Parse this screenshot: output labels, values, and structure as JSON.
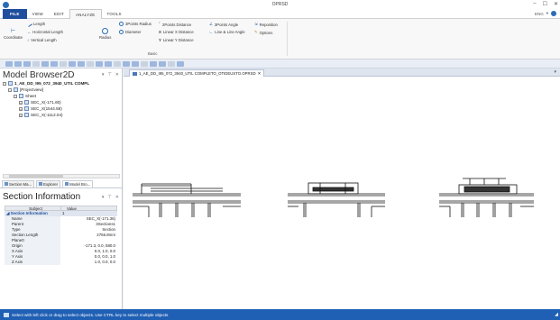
{
  "window": {
    "title": "OPRSD",
    "controls": [
      "–",
      "☐",
      "✕"
    ]
  },
  "menu": {
    "items": [
      "FILE",
      "VIEW",
      "EDIT",
      "ANALYZE",
      "TOOLS"
    ],
    "active": "ANALYZE",
    "user": "ENG"
  },
  "ribbon": {
    "coordinate": "Coordinate",
    "length": "Length",
    "horizontal_length": "Horizontal Length",
    "vertical_length": "Vertical Length",
    "radius": "Radius",
    "three_points_radius": "3Points Radius",
    "diameter": "Diameter",
    "two_points_distance": "2Points Distance",
    "linear_x_distance": "Linear X Distance",
    "linear_y_distance": "Linear Y Distance",
    "three_points_angle": "3Points Angle",
    "line_line_angle": "Line & Line Angle",
    "reposition": "Reposition",
    "options": "Options",
    "group_basic": "Basic"
  },
  "model_browser": {
    "title": "Model Browser2D",
    "tree": [
      {
        "label": "1_AE_DD_I95_072_3940_UTIL COMPL",
        "level": 0,
        "expander": "-"
      },
      {
        "label": "[Projectview]",
        "level": 1,
        "expander": "-"
      },
      {
        "label": "Sheet",
        "level": 2,
        "expander": "-"
      },
      {
        "label": "SEC_X(-171.60)",
        "level": 3,
        "expander": "+"
      },
      {
        "label": "SEC_X(1544.58)",
        "level": 3,
        "expander": "+"
      },
      {
        "label": "SEC_X(-1112.04)",
        "level": 3,
        "expander": "+"
      }
    ],
    "tabs": [
      "Section Ma...",
      "Explorer",
      "Model Bro..."
    ]
  },
  "section_info": {
    "title": "Section Information",
    "columns": [
      "Subject",
      "Value"
    ],
    "group": {
      "label": "Section Information",
      "value": "1"
    },
    "rows": [
      {
        "k": "Name",
        "v": "SEC_X(-171.36)"
      },
      {
        "k": "Parent",
        "v": "3Sections1"
      },
      {
        "k": "Type",
        "v": "Section"
      },
      {
        "k": "Section Length",
        "v": "2766.8mm"
      },
      {
        "k": "Plane0",
        "v": ""
      },
      {
        "k": "Origin",
        "v": "-171.3, 0.0, 580.0"
      },
      {
        "k": "X Axis",
        "v": "0.0, 1.0, 0.0"
      },
      {
        "k": "Y Axis",
        "v": "0.0, 0.0, 1.0"
      },
      {
        "k": "Z Axis",
        "v": "1.0, 0.0, 0.0"
      }
    ]
  },
  "document": {
    "tab_label": "1_AE_DD_I95_072_3940_UTIL COMPLETO_OTIDEUSTO.OPRSD"
  },
  "status": {
    "text": "Select with left click or drag to select objects. Use CTRL key to select multiple objects"
  },
  "colors": {
    "accent": "#1f4e9c",
    "status_bar": "#1f5fb4",
    "toolbar_bg": "#e9eef6"
  }
}
